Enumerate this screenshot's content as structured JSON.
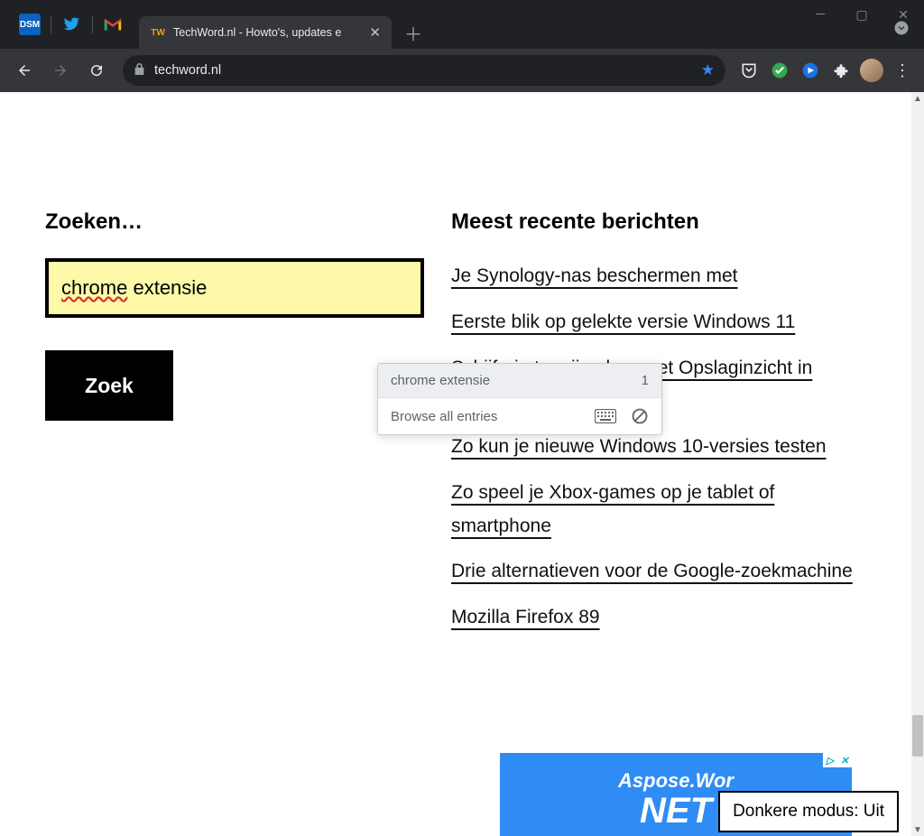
{
  "window": {
    "pinned_tabs": [
      "DSM",
      "twitter",
      "gmail"
    ],
    "tab": {
      "favicon_text": "TW",
      "title": "TechWord.nl - Howto's, updates e"
    },
    "url": "techword.nl"
  },
  "search": {
    "heading": "Zoeken…",
    "value_misspelled": "chrome",
    "value_rest": " extensie",
    "button": "Zoek"
  },
  "autofill": {
    "suggestion": "chrome extensie",
    "count": "1",
    "browse_all": "Browse all entries"
  },
  "recent": {
    "heading": "Meest recente berichten",
    "posts": [
      "Je Synology-nas beschermen met",
      "Eerste blik op gelekte versie Windows 11",
      "Schijfruimte vrijmaken met Opslaginzicht in Windows 10",
      "Zo kun je nieuwe Windows 10-versies testen",
      "Zo speel je Xbox-games op je tablet of smartphone",
      "Drie alternatieven voor de Google-zoekmachine",
      "Mozilla Firefox 89"
    ]
  },
  "ad": {
    "line1": "Aspose.Wor",
    "line2": "NET"
  },
  "dark_mode": {
    "label": "Donkere modus:",
    "state": "Uit"
  }
}
